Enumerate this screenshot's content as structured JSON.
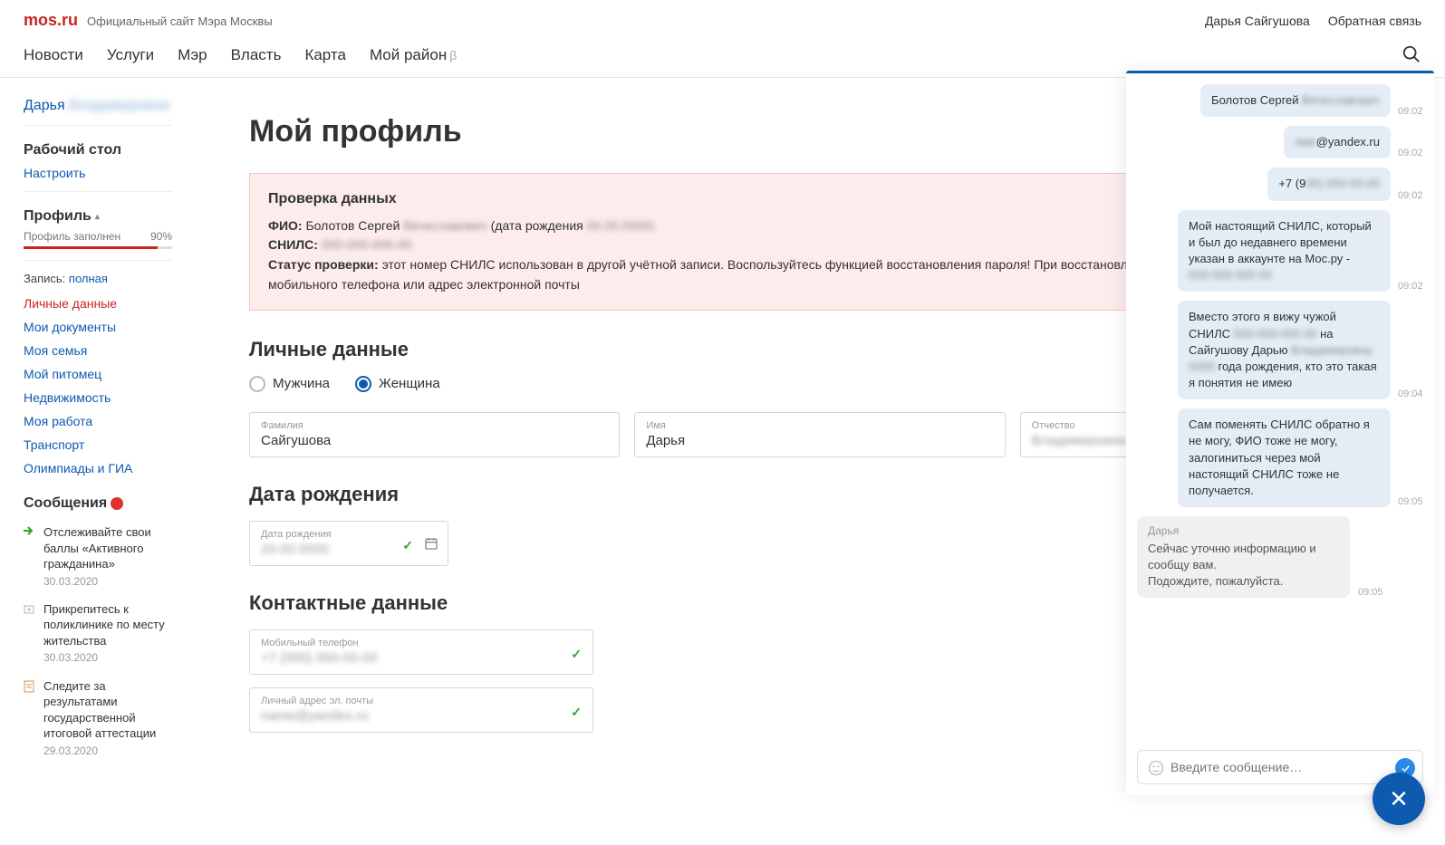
{
  "topbar": {
    "logo": "mos.ru",
    "tagline": "Официальный сайт Мэра Москвы",
    "user": "Дарья Сайгушова",
    "feedback": "Обратная связь"
  },
  "nav": {
    "items": [
      "Новости",
      "Услуги",
      "Мэр",
      "Власть",
      "Карта",
      "Мой район"
    ],
    "beta": "β"
  },
  "sidebar": {
    "username_first": "Дарья",
    "username_rest": "Владимировна",
    "desktop_h": "Рабочий стол",
    "configure": "Настроить",
    "profile_h": "Профиль",
    "fill_label": "Профиль заполнен",
    "fill_pct": "90%",
    "record_lbl": "Запись:",
    "record_val": "полная",
    "links": [
      "Личные данные",
      "Мои документы",
      "Моя семья",
      "Мой питомец",
      "Недвижимость",
      "Моя работа",
      "Транспорт",
      "Олимпиады и ГИА"
    ],
    "messages_h": "Сообщения",
    "messages": [
      {
        "text": "Отслеживайте свои баллы «Активного гражданина»",
        "date": "30.03.2020"
      },
      {
        "text": "Прикрепитесь к поликлинике по месту жительства",
        "date": "30.03.2020"
      },
      {
        "text": "Следите за результатами государственной итоговой аттестации",
        "date": "29.03.2020"
      }
    ]
  },
  "main": {
    "title": "Мой профиль",
    "alert": {
      "h": "Проверка данных",
      "fio_lbl": "ФИО:",
      "fio_val": "Болотов Сергей",
      "fio_blur": "Вячеславович",
      "dob_lbl": "(дата рождения",
      "dob_blur": "00.00.0000)",
      "snils_lbl": "СНИЛС:",
      "snils_blur": "000-000-000-00",
      "status_lbl": "Статус проверки:",
      "status_val": "этот номер СНИЛС использован в другой учётной записи. Воспользуйтесь функцией восстановления пароля! При восстановлении необходимо использовать номер мобильного телефона или адрес электронной почты"
    },
    "section_personal": "Личные данные",
    "gender": {
      "male": "Мужчина",
      "female": "Женщина"
    },
    "fields": {
      "surname_lbl": "Фамилия",
      "surname_val": "Сайгушова",
      "name_lbl": "Имя",
      "name_val": "Дарья",
      "patr_lbl": "Отчество",
      "patr_val": "Владимировна"
    },
    "section_dob": "Дата рождения",
    "dob_lbl": "Дата рождения",
    "dob_val": "20.00.0000",
    "section_contacts": "Контактные данные",
    "phone_lbl": "Мобильный телефон",
    "phone_val": "+7 (000) 000-00-00",
    "email_lbl": "Личный адрес эл. почты",
    "email_val": "name@yandex.ru"
  },
  "chat": {
    "messages": [
      {
        "side": "r",
        "text": "Болотов Сергей ",
        "blur": "Вячeславович",
        "time": "09:02"
      },
      {
        "side": "r",
        "blur": "имя",
        "text": "@yandex.ru",
        "time": "09:02"
      },
      {
        "side": "r",
        "text": "+7 (9",
        "blur": "00) 000-00-00",
        "time": "09:02"
      },
      {
        "side": "r",
        "text": "Мой настоящий СНИЛС, который и был до недавнего времени указан в аккаунте на Мос.ру - ",
        "blur": "000-000-000 00",
        "time": "09:02"
      },
      {
        "side": "r",
        "text_a": "Вместо этого я вижу чужой СНИЛС ",
        "blur_a": "000-000-000 00",
        "text_b": " на Сайгушову Дарью ",
        "blur_b": "Владимировну 0000",
        "text_c": " года рождения, кто это такая я понятия не имею",
        "time": "09:04"
      },
      {
        "side": "r",
        "text": "Сам поменять СНИЛС обратно я не могу, ФИО тоже не могу, залогиниться через мой настоящий СНИЛС тоже не получается.",
        "time": "09:05"
      },
      {
        "side": "l",
        "name": "Дарья",
        "text": "Сейчас уточню информацию и сообщу вам.\nПодождите, пожалуйста.",
        "time": "09:05"
      }
    ],
    "placeholder": "Введите сообщение…"
  }
}
